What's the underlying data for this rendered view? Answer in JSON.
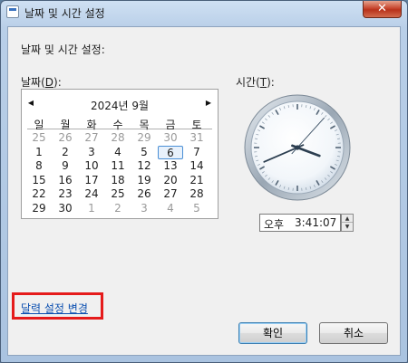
{
  "window": {
    "title": "날짜 및 시간 설정",
    "close_glyph": "✕"
  },
  "heading": "날짜 및 시간 설정:",
  "date_label": {
    "text": "날짜(",
    "mnemonic": "D",
    "suffix": "):"
  },
  "time_label": {
    "text": "시간(",
    "mnemonic": "T",
    "suffix": "):"
  },
  "calendar": {
    "month_title": "2024년 9월",
    "prev_glyph": "◀",
    "next_glyph": "▶",
    "weekdays": [
      "일",
      "월",
      "화",
      "수",
      "목",
      "금",
      "토"
    ],
    "selected_day": "6",
    "weeks": [
      [
        "25",
        "26",
        "27",
        "28",
        "29",
        "30",
        "31"
      ],
      [
        "1",
        "2",
        "3",
        "4",
        "5",
        "6",
        "7"
      ],
      [
        "8",
        "9",
        "10",
        "11",
        "12",
        "13",
        "14"
      ],
      [
        "15",
        "16",
        "17",
        "18",
        "19",
        "20",
        "21"
      ],
      [
        "22",
        "23",
        "24",
        "25",
        "26",
        "27",
        "28"
      ],
      [
        "29",
        "30",
        "1",
        "2",
        "3",
        "4",
        "5"
      ]
    ]
  },
  "clock": {
    "hour": 3,
    "minute": 41,
    "second": 7
  },
  "time": {
    "ampm": "오후",
    "value": "3:41:07",
    "spin_up": "▲",
    "spin_down": "▼"
  },
  "link": {
    "label": "달력 설정 변경"
  },
  "buttons": {
    "ok": "확인",
    "cancel": "취소"
  },
  "colors": {
    "highlight": "#e51b1b",
    "link": "#0b4fb0",
    "selected_border": "#4a8fd6"
  }
}
